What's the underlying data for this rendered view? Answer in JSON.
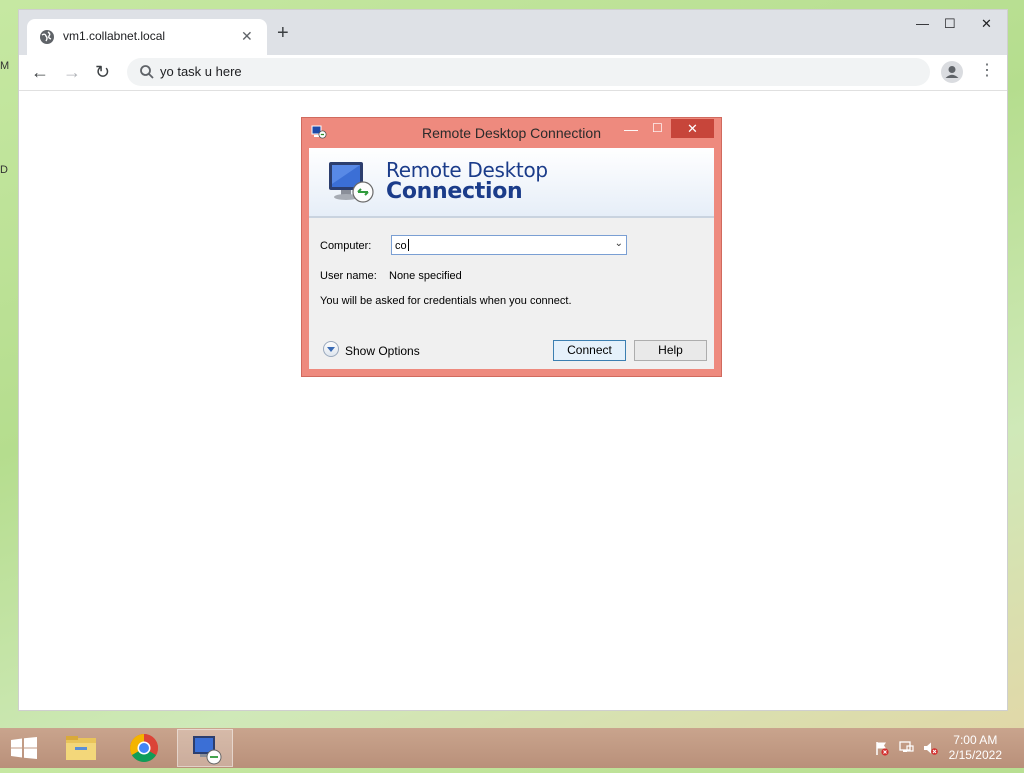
{
  "desktop": {
    "glyph1": "M",
    "glyph2": "D"
  },
  "browser": {
    "tab_title": "vm1.collabnet.local",
    "tab_close": "✕",
    "new_tab": "+",
    "window_controls": {
      "minimize": "—",
      "maximize": "☐",
      "close": "✕"
    },
    "nav": {
      "back": "←",
      "forward": "→",
      "reload": "↻"
    },
    "address_text": "yo task u here",
    "menu": "⋮",
    "icons": [
      "globe-icon",
      "search-icon",
      "profile-icon",
      "menu-icon"
    ]
  },
  "rdc": {
    "title": "Remote Desktop Connection",
    "banner_line1": "Remote Desktop",
    "banner_line2": "Connection",
    "computer_label": "Computer:",
    "computer_value": "co",
    "username_label": "User name:",
    "username_value": "None specified",
    "credentials_note": "You will be asked for credentials when you connect.",
    "show_options": "Show Options",
    "connect": "Connect",
    "help": "Help",
    "close_glyph": "✕",
    "min_glyph": "—",
    "max_glyph": "☐",
    "colors": {
      "titlebar": "#ee8a7e",
      "close": "#c7453a",
      "banner_text": "#1b3c8a"
    }
  },
  "taskbar": {
    "time": "7:00 AM",
    "date": "2/15/2022",
    "items": [
      "file-explorer",
      "chrome",
      "remote-desktop"
    ],
    "tray": [
      "action-center-flag-icon",
      "network-icon",
      "volume-muted-icon"
    ]
  }
}
